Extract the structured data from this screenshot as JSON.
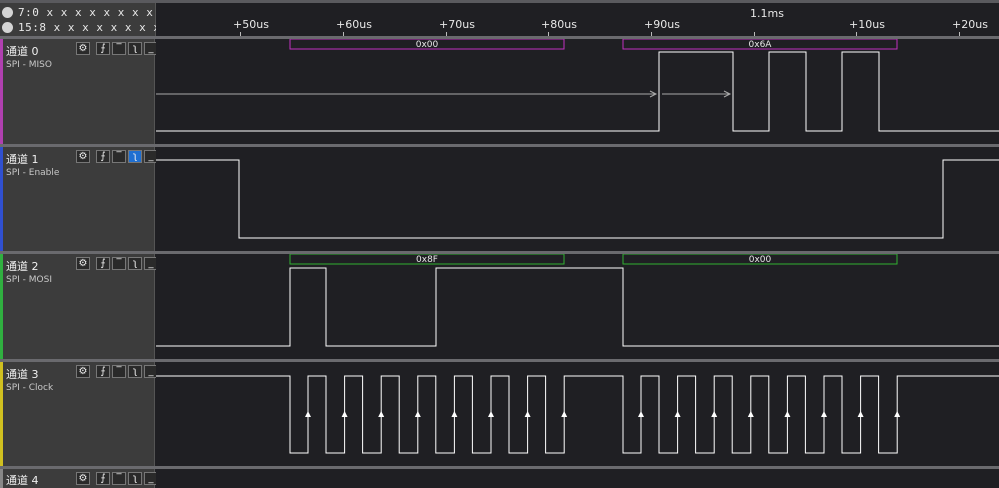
{
  "trigger_summary": {
    "row1": "7:0 x x x x x x x x",
    "row2": "15:8 x x x x x x x x"
  },
  "ruler": {
    "top_label": "1.1ms",
    "ticks": [
      "+50us",
      "+60us",
      "+70us",
      "+80us",
      "+90us",
      "+10us",
      "+20us"
    ]
  },
  "channels": [
    {
      "name": "通道 0",
      "protocol": "SPI - MISO",
      "accent": "#b040b0"
    },
    {
      "name": "通道 1",
      "protocol": "SPI - Enable",
      "accent": "#3050d0"
    },
    {
      "name": "通道 2",
      "protocol": "SPI - MOSI",
      "accent": "#30b040"
    },
    {
      "name": "通道 3",
      "protocol": "SPI - Clock",
      "accent": "#d0c020"
    },
    {
      "name": "通道 4",
      "protocol": "",
      "accent": "#888888"
    }
  ],
  "buttons": {
    "settings_icon": "gear-icon",
    "rising_icon": "rising-edge-icon",
    "high_icon": "high-level-icon",
    "falling_icon": "falling-edge-icon",
    "low_icon": "low-level-icon"
  },
  "decoded": {
    "miso": [
      "0x00",
      "0x6A"
    ],
    "mosi": [
      "0x8F",
      "0x00"
    ]
  },
  "colors": {
    "miso_bubble": "#c030c0",
    "mosi_bubble": "#30b030",
    "wave": "#ffffff"
  }
}
